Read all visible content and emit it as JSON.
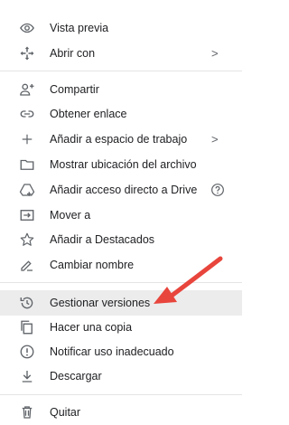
{
  "menu": {
    "items": [
      {
        "label": "Vista previa",
        "icon": "eye-icon"
      },
      {
        "label": "Abrir con",
        "icon": "move-arrows-icon",
        "submenu": true
      },
      {
        "label": "Compartir",
        "icon": "person-add-icon"
      },
      {
        "label": "Obtener enlace",
        "icon": "link-icon"
      },
      {
        "label": "Añadir a espacio de trabajo",
        "icon": "plus-icon",
        "submenu": true
      },
      {
        "label": "Mostrar ubicación del archivo",
        "icon": "folder-icon"
      },
      {
        "label": "Añadir acceso directo a Drive",
        "icon": "drive-shortcut-icon",
        "help": true
      },
      {
        "label": "Mover a",
        "icon": "move-to-folder-icon"
      },
      {
        "label": "Añadir a Destacados",
        "icon": "star-icon"
      },
      {
        "label": "Cambiar nombre",
        "icon": "pencil-icon"
      },
      {
        "label": "Gestionar versiones",
        "icon": "history-icon",
        "highlighted": true
      },
      {
        "label": "Hacer una copia",
        "icon": "copy-icon"
      },
      {
        "label": "Notificar uso inadecuado",
        "icon": "report-icon"
      },
      {
        "label": "Descargar",
        "icon": "download-icon"
      },
      {
        "label": "Quitar",
        "icon": "trash-icon"
      }
    ],
    "submenu_glyph": ">",
    "highlight_color": "#ececec",
    "annotation_arrow_color": "#e8453c"
  }
}
